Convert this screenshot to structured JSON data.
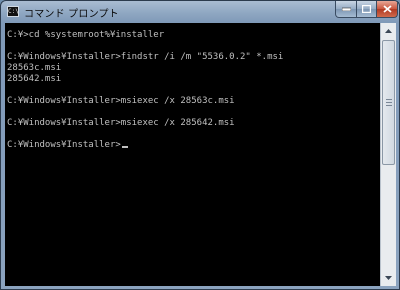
{
  "window": {
    "title": "コマンド プロンプト",
    "icon_text": "C:\\",
    "controls": [
      "minimize-icon",
      "maximize-icon",
      "close-icon"
    ]
  },
  "console": {
    "lines": [
      "C:¥>cd %systemroot%¥installer",
      "",
      "C:¥Windows¥Installer>findstr /i /m \"5536.0.2\" *.msi",
      "28563c.msi",
      "285642.msi",
      "",
      "C:¥Windows¥Installer>msiexec /x 28563c.msi",
      "",
      "C:¥Windows¥Installer>msiexec /x 285642.msi",
      "",
      "C:¥Windows¥Installer>"
    ]
  },
  "colors": {
    "console_bg": "#000000",
    "console_text": "#c0c0c0",
    "close_button": "#c8553d"
  }
}
